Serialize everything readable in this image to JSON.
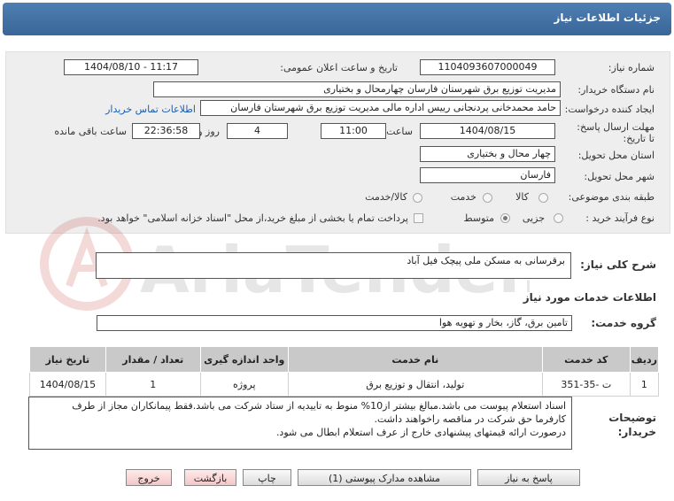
{
  "window": {
    "title": "جزئیات اطلاعات نیاز"
  },
  "form": {
    "need_number_label": "شماره نیاز:",
    "need_number": "1104093607000049",
    "announce_label": "تاریخ و ساعت اعلان عمومی:",
    "announce_value": "1404/08/10 - 11:17",
    "buyer_label": "نام دستگاه خریدار:",
    "buyer_value": "مدیریت توزیع برق شهرستان فارسان چهارمحال و بختیاری",
    "requester_label": "ایجاد کننده درخواست:",
    "requester_value": "حامد محمدخانی پردنجانی رییس اداره مالی مدیریت توزیع برق شهرستان فارسان",
    "contact_link": "اطلاعات تماس خریدار",
    "deadline_label": "مهلت ارسال پاسخ: تا تاریخ:",
    "deadline_date": "1404/08/15",
    "time_label": "ساعت",
    "deadline_time": "11:00",
    "days_value": "4",
    "days_label": "روز و",
    "remaining_time": "22:36:58",
    "remaining_label": "ساعت باقی مانده",
    "province_label": "استان محل تحویل:",
    "province_value": "چهار محال و بختیاری",
    "city_label": "شهر محل تحویل:",
    "city_value": "فارسان",
    "category_label": "طبقه بندی موضوعی:",
    "category_options": {
      "goods": "کالا",
      "service": "خدمت",
      "goods_service": "کالا/خدمت"
    },
    "process_label": "نوع فرآیند خرید :",
    "process_options": {
      "minor": "جزیی",
      "medium": "متوسط"
    },
    "payment_note": "پرداخت تمام یا بخشی از مبلغ خرید،از محل \"اسناد خزانه اسلامی\" خواهد بود."
  },
  "description": {
    "label": "شرح کلی نیاز:",
    "value": "برقرسانی به مسکن ملی پیچک فیل آباد"
  },
  "services": {
    "section_title": "اطلاعات خدمات مورد نیاز",
    "group_label": "گروه خدمت:",
    "group_value": "تامین برق، گاز، بخار و تهویه هوا",
    "columns": [
      "ردیف",
      "کد خدمت",
      "نام خدمت",
      "واحد اندازه گیری",
      "تعداد / مقدار",
      "تاریخ نیاز"
    ],
    "rows": [
      {
        "row": "1",
        "code": "ت -35-351",
        "name": "تولید، انتقال و توزیع برق",
        "unit": "پروژه",
        "qty": "1",
        "date": "1404/08/15"
      }
    ]
  },
  "buyer_notes": {
    "label": "توضیحات خریدار:",
    "lines": [
      "اسناد استعلام پیوست می باشد.مبالغ بیشتر از10% منوط به تاییدیه از ستاد شرکت می باشد.فقط پیمانکاران مجاز از طرف",
      "کارفرما حق شرکت در مناقصه راخواهند داشت.",
      "درصورت ارائه قیمتهای پیشنهادی خارج از عرف استعلام ابطال می شود."
    ]
  },
  "buttons": {
    "reply": "پاسخ به نیاز",
    "attachments": "مشاهده مدارک پیوستی (1)",
    "print": "چاپ",
    "back": "بازگشت",
    "exit": "خروج"
  },
  "watermark": {
    "text": "AriaTender.neT"
  }
}
